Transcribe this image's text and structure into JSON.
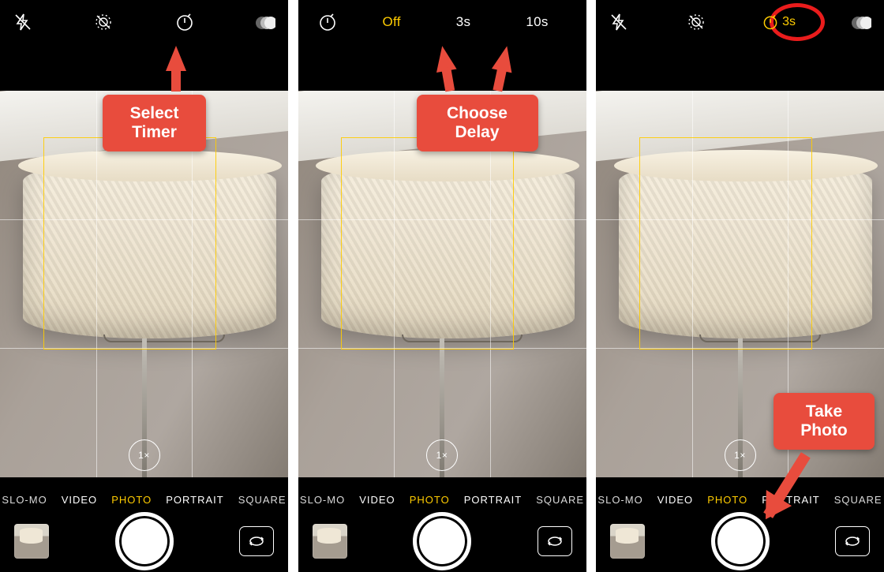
{
  "frames": [
    {
      "topbar_mode": "icons",
      "callout": {
        "line1": "Select",
        "line2": "Timer"
      }
    },
    {
      "topbar_mode": "timer_options",
      "timer_options": {
        "off": "Off",
        "opt1": "3s",
        "opt2": "10s"
      },
      "callout": {
        "line1": "Choose",
        "line2": "Delay"
      }
    },
    {
      "topbar_mode": "icons_active",
      "timer_active_label": "3s",
      "callout": {
        "line1": "Take",
        "line2": "Photo"
      }
    }
  ],
  "zoom_label": "1×",
  "modes": {
    "slomo": "SLO-MO",
    "video": "VIDEO",
    "photo": "PHOTO",
    "portrait": "PORTRAIT",
    "square": "SQUARE"
  }
}
